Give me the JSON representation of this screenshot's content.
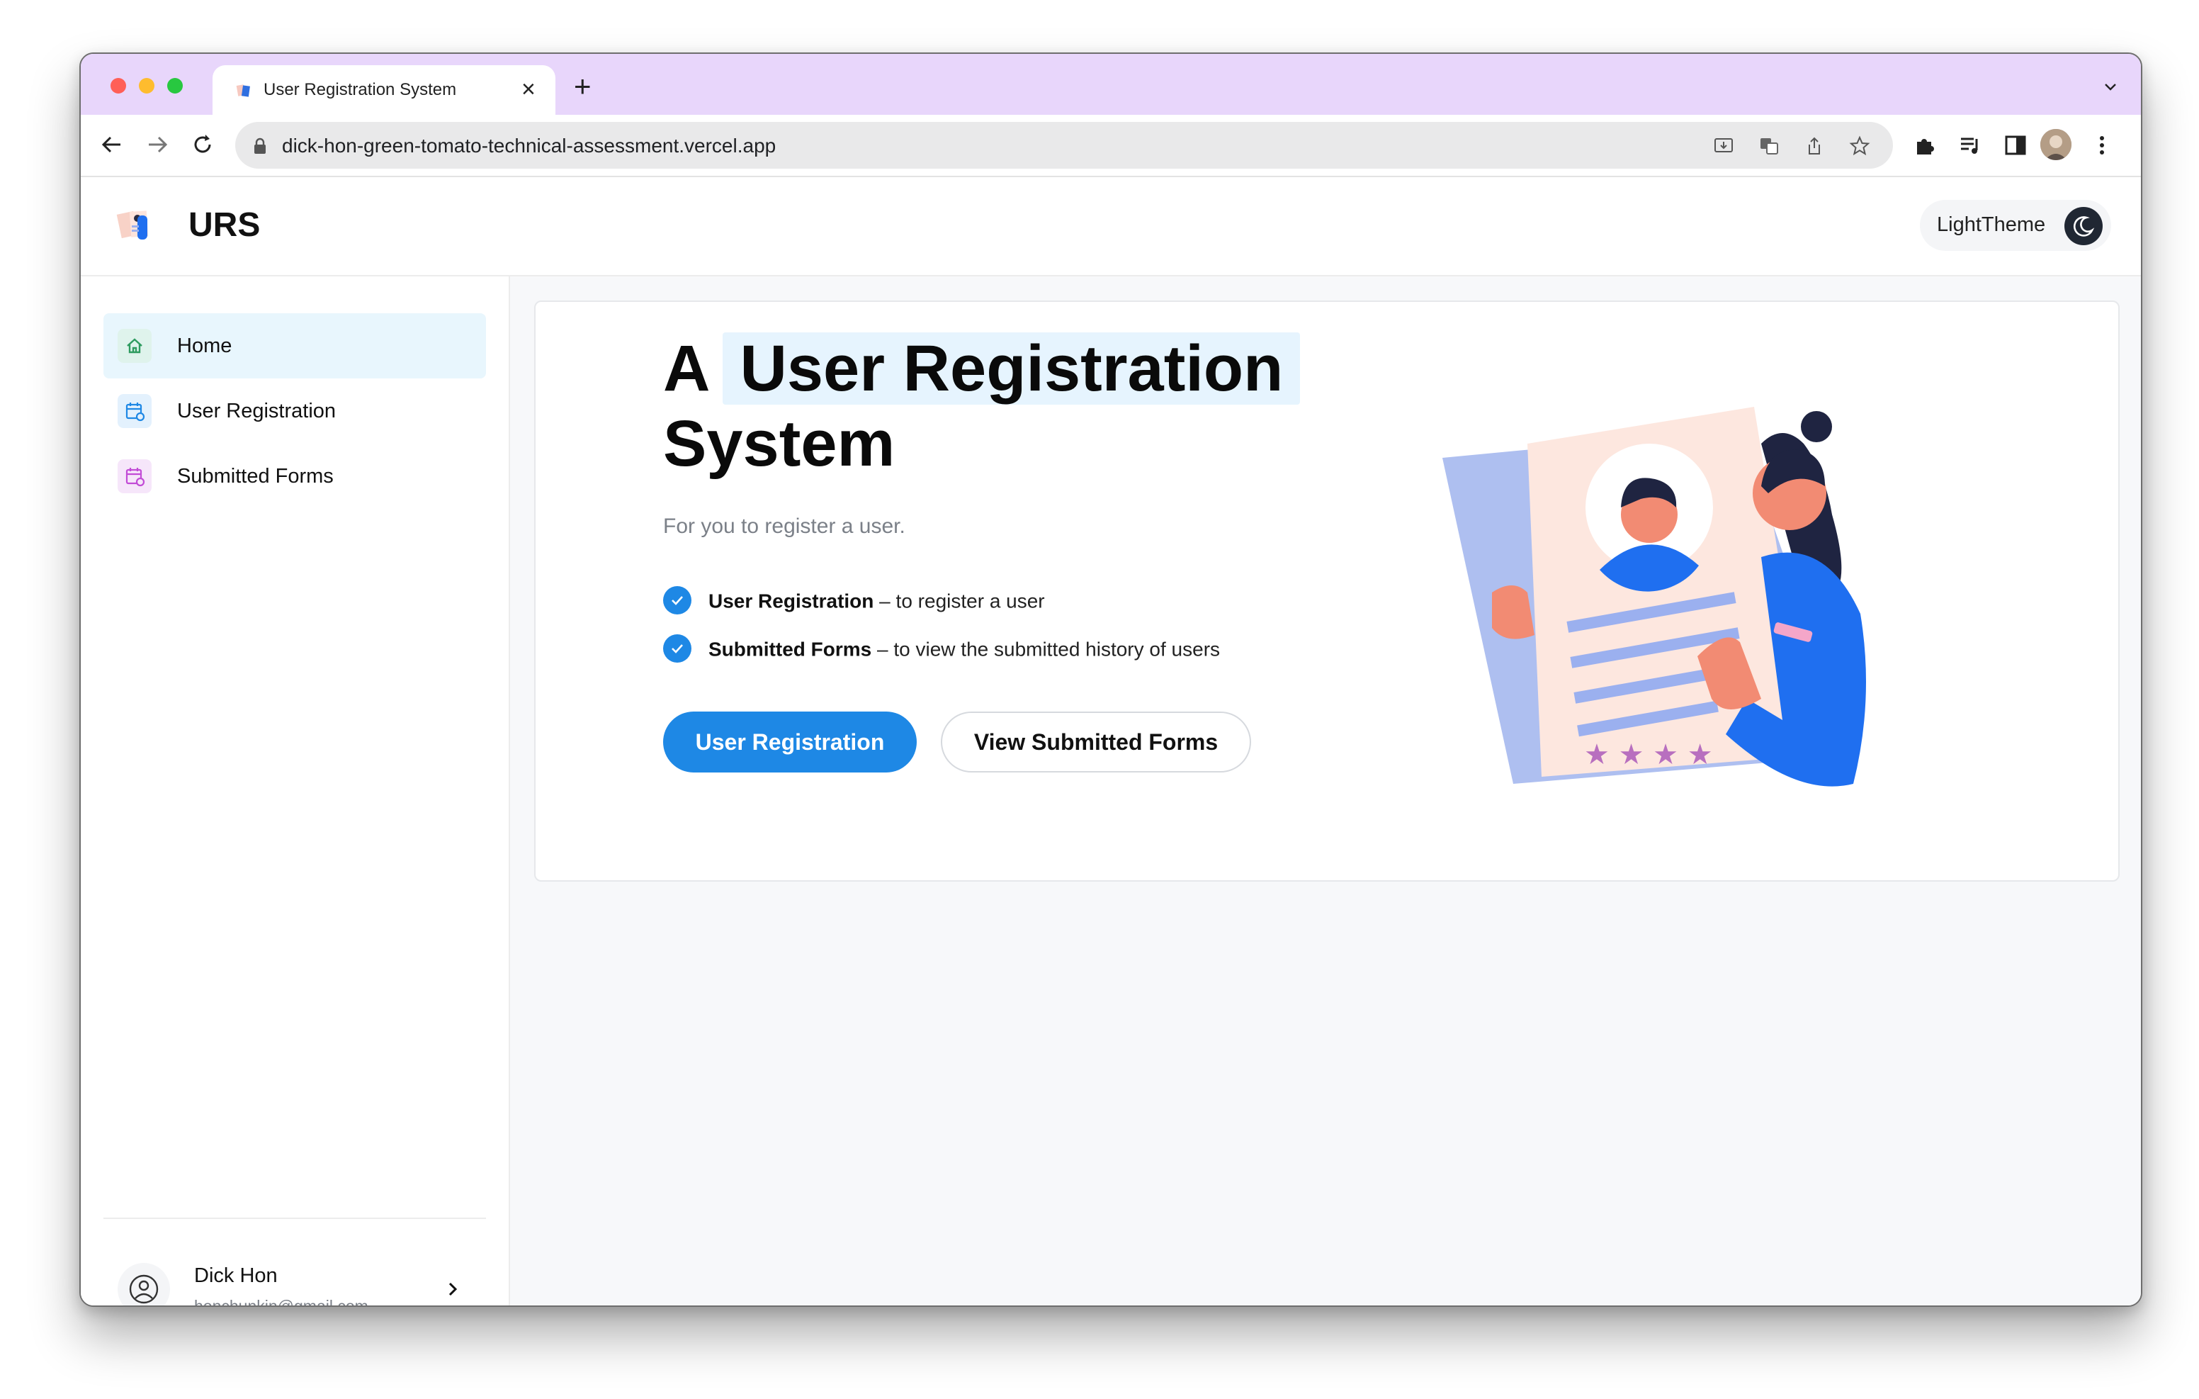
{
  "browser": {
    "tab_title": "User Registration System",
    "tab_close": "×",
    "new_tab": "+",
    "url": "dick-hon-green-tomato-technical-assessment.vercel.app"
  },
  "header": {
    "brand": "URS",
    "theme_label": "LightTheme"
  },
  "sidebar": {
    "items": [
      {
        "label": "Home",
        "icon": "home-icon",
        "active": true,
        "icon_color": "#2e9b5f"
      },
      {
        "label": "User Registration",
        "icon": "calendar-icon",
        "active": false,
        "icon_color": "#1e88e5"
      },
      {
        "label": "Submitted Forms",
        "icon": "calendar-icon",
        "active": false,
        "icon_color": "#c24bd6"
      }
    ],
    "user": {
      "name": "Dick Hon",
      "email": "honchunkin@gmail.com"
    }
  },
  "main": {
    "headline_prefix": "A",
    "headline_highlight": "User Registration",
    "headline_line2": "System",
    "subtitle": "For you to register a user.",
    "features": [
      {
        "title": "User Registration",
        "desc": " – to register a user"
      },
      {
        "title": "Submitted Forms",
        "desc": " – to view the submitted history of users"
      }
    ],
    "primary_button": "User Registration",
    "secondary_button": "View Submitted Forms"
  },
  "colors": {
    "accent": "#1e88e5",
    "tab_strip": "#e8d6fb",
    "highlight": "#e6f4fe",
    "active_nav": "#e8f6fd"
  }
}
